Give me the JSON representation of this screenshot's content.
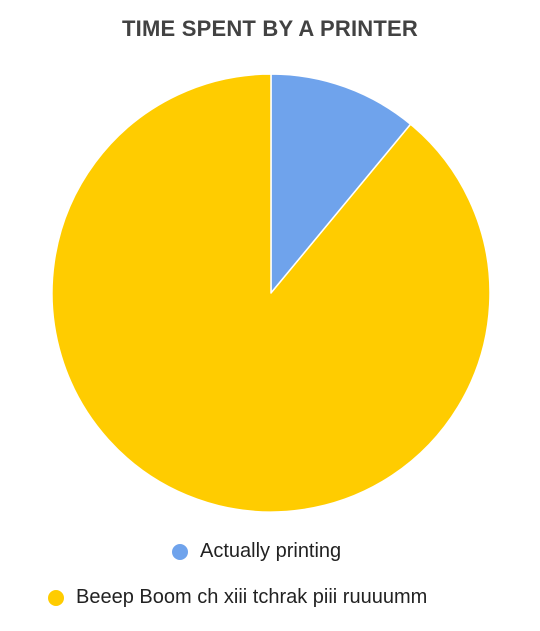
{
  "chart_data": {
    "type": "pie",
    "title": "TIME SPENT BY A PRINTER",
    "slices": [
      {
        "label": "Actually printing",
        "value": 11,
        "color": "#6FA3EC"
      },
      {
        "label": "Beeep Boom ch xiii tchrak piii ruuuumm",
        "value": 89,
        "color": "#FFCC00"
      }
    ],
    "start_angle_deg": 0,
    "direction": "clockwise",
    "legend_position": "bottom"
  }
}
